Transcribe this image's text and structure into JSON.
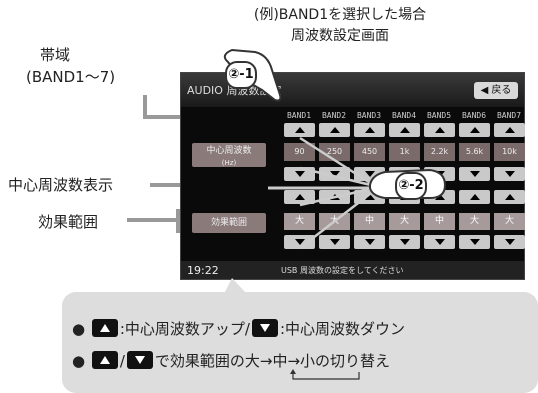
{
  "captions": {
    "title_line1": "(例)BAND1を選択した場合",
    "title_line2": "周波数設定画面",
    "band_label_line1": "帯域",
    "band_label_line2": "(BAND1～7)",
    "center_freq_label": "中心周波数表示",
    "effect_label": "効果範囲"
  },
  "callouts": {
    "c1": "②-1",
    "c2": "②-2"
  },
  "screen": {
    "header_title": "AUDIO 周波数設定",
    "back_button": "◀ 戻る",
    "bands": [
      "BAND1",
      "BAND2",
      "BAND3",
      "BAND4",
      "BAND5",
      "BAND6",
      "BAND7"
    ],
    "center_freq_button": "中心周波数",
    "center_freq_sub": "(Hz)",
    "freq_values": [
      "90",
      "250",
      "450",
      "1k",
      "2.2k",
      "5.6k",
      "10k"
    ],
    "effect_button": "効果範囲",
    "effect_values": [
      "大",
      "大",
      "中",
      "大",
      "中",
      "大",
      "大"
    ],
    "time": "19:22",
    "status_msg": "USB 周波数の設定をしてください"
  },
  "bubble": {
    "line1_a": ":中心周波数アップ/",
    "line1_b": ":中心周波数ダウン",
    "line2_sep": "/",
    "line2_b": "で効果範囲の大→中→小の切り替え"
  }
}
